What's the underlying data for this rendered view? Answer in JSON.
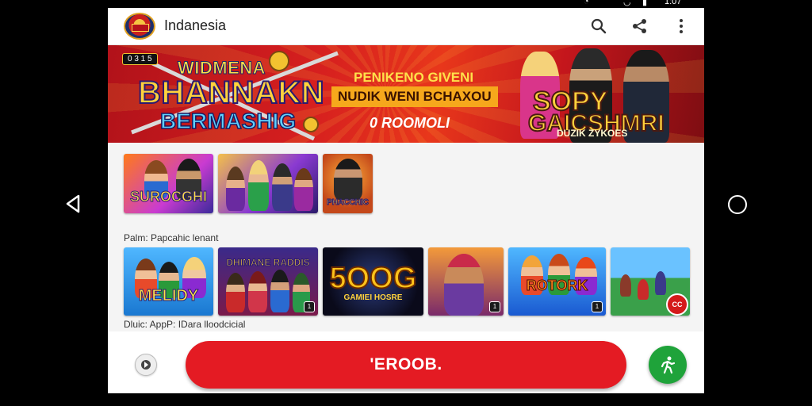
{
  "status_bar": {
    "time": "1:07"
  },
  "app": {
    "title": "Indanesia"
  },
  "hero": {
    "badge": "0 3 1 5",
    "title_top": "WIDMENA",
    "title_main": "BHANNAKN",
    "title_sub": "BERMASHIG",
    "promo_line_1": "PENIKENO GIVENI",
    "promo_line_2": "NUDIK WENI BCHAXOU",
    "promo_line_3": "0 ROOMOLI",
    "right_title_1": "SOPY",
    "right_title_2": "GAICSHMRI",
    "right_caption": "DUZIK ZYKOES"
  },
  "featured_tiles": [
    {
      "label": "SUROCGHI"
    },
    {
      "label": ""
    },
    {
      "label": "PHACCHIC"
    }
  ],
  "section_1": {
    "label": "Palm: Papcahic lenant"
  },
  "popular_tiles": [
    {
      "label": "MELIDY",
      "badge": ""
    },
    {
      "label": "DHIMANE RADDIS",
      "badge": "1"
    },
    {
      "label": "5OOG",
      "sub_label": "GAMIEI HOSRE",
      "badge": ""
    },
    {
      "label": "",
      "badge": "1"
    },
    {
      "label": "ROTORK",
      "badge": "1"
    },
    {
      "label": "",
      "badge": "CC"
    }
  ],
  "section_2": {
    "label": "Dluic: AppP: IDara lloodcicial"
  },
  "bottom": {
    "main_button_label": "'EROOB."
  },
  "colors": {
    "brand_red": "#e41b23",
    "fab_green": "#1fa33a"
  }
}
